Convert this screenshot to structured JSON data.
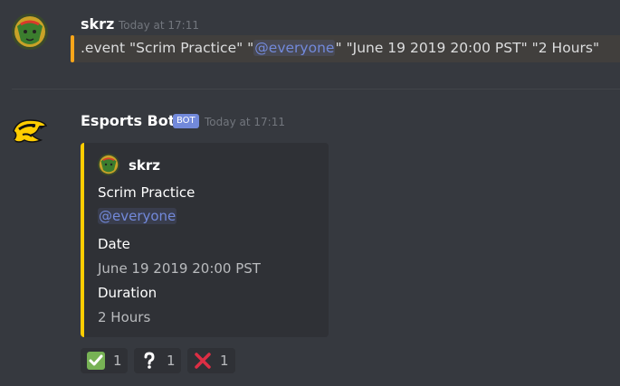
{
  "message1": {
    "username": "skrz",
    "timestamp": "Today at 17:11",
    "content_prefix": ".event \"Scrim Practice\"  \"",
    "content_mention": "@everyone",
    "content_suffix": "\" \"June 19 2019 20:00 PST\" \"2 Hours\""
  },
  "message2": {
    "username": "Esports Bot",
    "bot_tag": "BOT",
    "timestamp": "Today at 17:11",
    "embed": {
      "author": "skrz",
      "title": "Scrim Practice",
      "mention": "@everyone",
      "fields": [
        {
          "name": "Date",
          "value": "June 19 2019 20:00 PST"
        },
        {
          "name": "Duration",
          "value": "2 Hours"
        }
      ],
      "accent_color": "#ffcd00"
    },
    "reactions": [
      {
        "emoji": "check-mark",
        "count": "1"
      },
      {
        "emoji": "question-mark",
        "count": "1"
      },
      {
        "emoji": "cross-mark",
        "count": "1"
      }
    ]
  },
  "colors": {
    "background": "#36393f",
    "mention": "#7289da",
    "highlight_bar": "#faa61a"
  }
}
